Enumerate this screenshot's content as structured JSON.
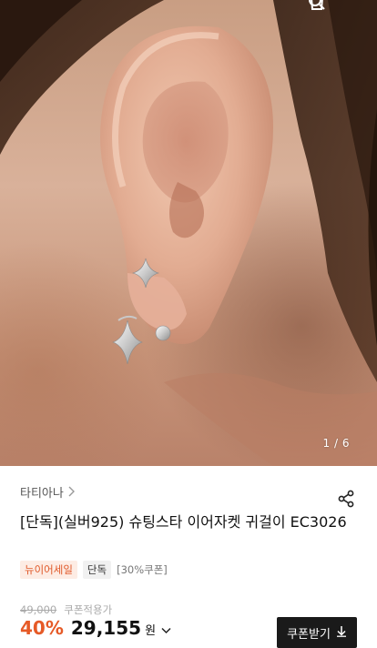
{
  "hero": {
    "image_subject": "ear wearing silver star ear jacket earring",
    "counter": "1 / 6"
  },
  "top_icons": [
    "search-icon",
    "cart-icon"
  ],
  "product": {
    "brand": "타티아나",
    "title": "[단독](실버925) 슈팅스타 이어자켓 귀걸이 EC3026",
    "tags": {
      "newyear": "뉴이어세일",
      "exclusive": "단독",
      "coupon": "[30%쿠폰]"
    },
    "original_price": "49,000",
    "coupon_applied": "쿠폰적용가",
    "discount": "40%",
    "price": "29,155",
    "currency": "원",
    "coupon_button": "쿠폰받기"
  },
  "colors": {
    "accent": "#e65a27",
    "tag_bg": "#fdece4",
    "button_bg": "#1a1a1a"
  }
}
